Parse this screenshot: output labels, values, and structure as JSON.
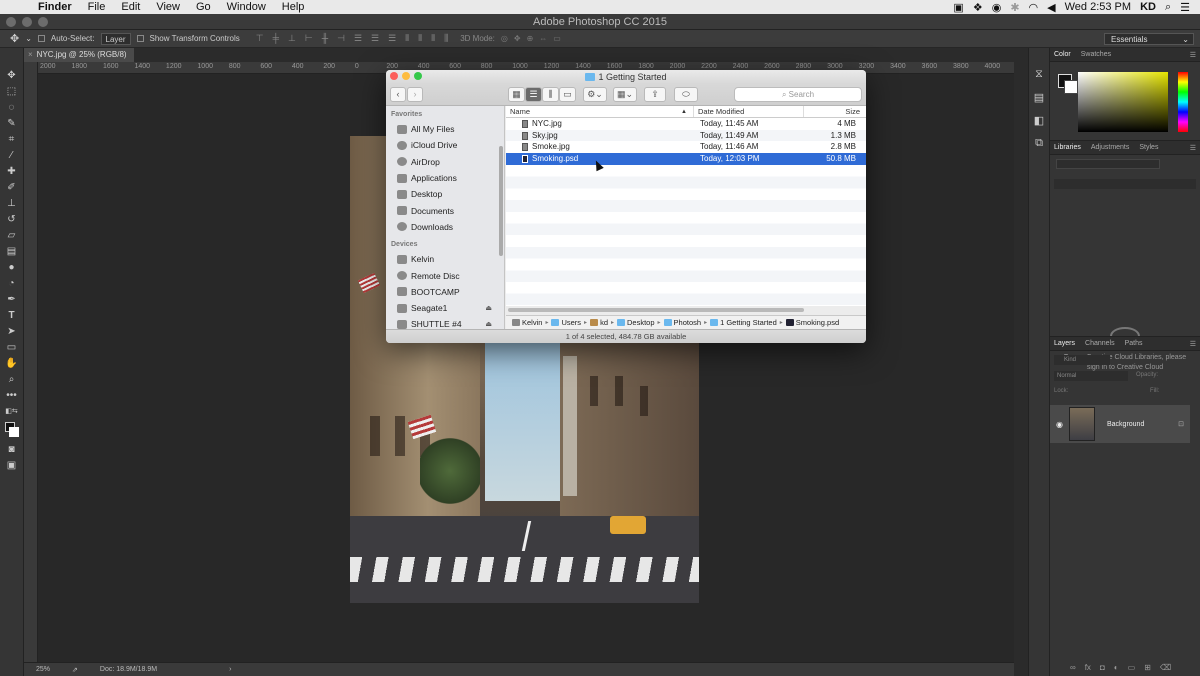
{
  "menubar": {
    "apple": "",
    "items": [
      "Finder",
      "File",
      "Edit",
      "View",
      "Go",
      "Window",
      "Help"
    ],
    "clock": "Wed 2:53 PM",
    "user": "KD"
  },
  "ps": {
    "title": "Adobe Photoshop CC 2015",
    "options": {
      "auto_select": "Auto-Select:",
      "layer_select": "Layer",
      "transform": "Show Transform Controls",
      "mode3d": "3D Mode:",
      "workspace": "Essentials"
    },
    "doc_tab": "NYC.jpg @ 25% (RGB/8)",
    "ruler_ticks": [
      "2000",
      "1800",
      "1600",
      "1400",
      "1200",
      "1000",
      "800",
      "600",
      "400",
      "200",
      "0",
      "200",
      "400",
      "600",
      "800",
      "1000",
      "1200",
      "1400",
      "1600",
      "1800",
      "2000",
      "2200",
      "2400",
      "2600",
      "2800",
      "3000",
      "3200",
      "3400",
      "3600",
      "3800",
      "4000"
    ],
    "status": {
      "zoom": "25%",
      "doc": "Doc: 18.9M/18.9M"
    },
    "panels": {
      "color_tabs": [
        "Color",
        "Swatches"
      ],
      "lib_tabs": [
        "Libraries",
        "Adjustments",
        "Styles"
      ],
      "cc_message": "To use Creative Cloud Libraries, please sign in to Creative Cloud",
      "layer_tabs": [
        "Layers",
        "Channels",
        "Paths"
      ],
      "kind": "Kind",
      "blend": "Normal",
      "opacity_label": "Opacity:",
      "lock_label": "Lock:",
      "fill_label": "Fill:",
      "layer_name": "Background"
    }
  },
  "finder": {
    "title": "1 Getting Started",
    "search_placeholder": "Search",
    "sidebar": {
      "favorites_header": "Favorites",
      "favorites": [
        "All My Files",
        "iCloud Drive",
        "AirDrop",
        "Applications",
        "Desktop",
        "Documents",
        "Downloads"
      ],
      "devices_header": "Devices",
      "devices": [
        "Kelvin",
        "Remote Disc",
        "BOOTCAMP",
        "Seagate1",
        "SHUTTLE #4"
      ]
    },
    "columns": {
      "name": "Name",
      "date": "Date Modified",
      "size": "Size"
    },
    "files": [
      {
        "name": "NYC.jpg",
        "date": "Today, 11:45 AM",
        "size": "4 MB"
      },
      {
        "name": "Sky.jpg",
        "date": "Today, 11:49 AM",
        "size": "1.3 MB"
      },
      {
        "name": "Smoke.jpg",
        "date": "Today, 11:46 AM",
        "size": "2.8 MB"
      },
      {
        "name": "Smoking.psd",
        "date": "Today, 12:03 PM",
        "size": "50.8 MB"
      }
    ],
    "path": [
      "Kelvin",
      "Users",
      "kd",
      "Desktop",
      "Photosh",
      "1 Getting Started",
      "Smoking.psd"
    ],
    "status": "1 of 4 selected, 484.78 GB available"
  },
  "colors": {
    "selection": "#2f6bd6",
    "ps_bg": "#282828"
  }
}
